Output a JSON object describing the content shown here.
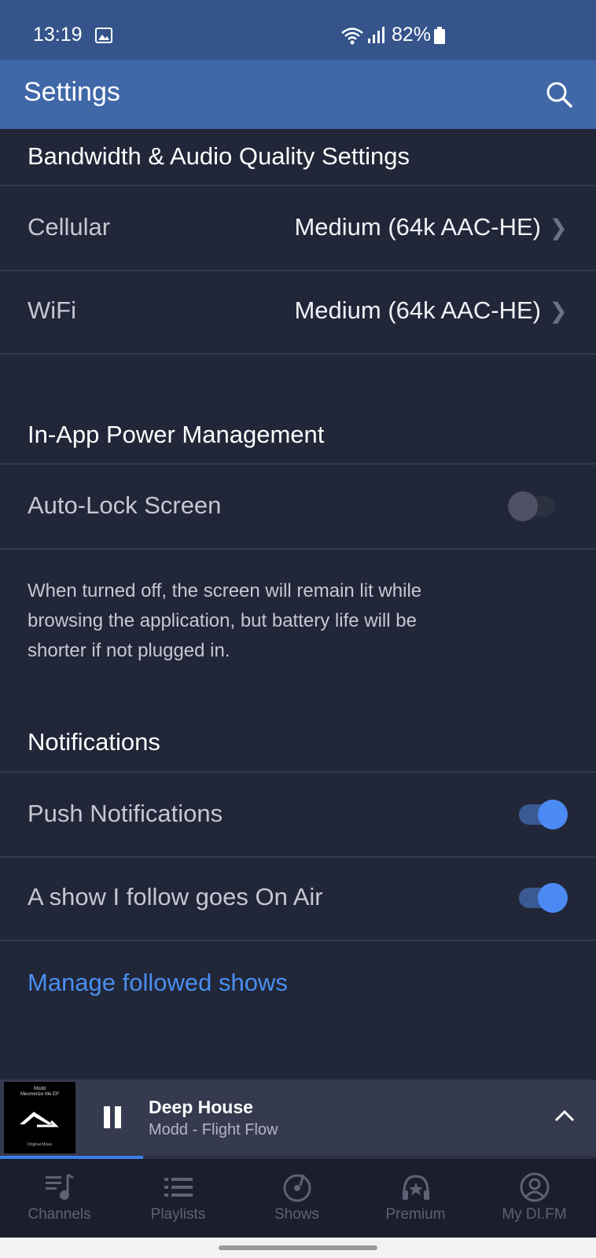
{
  "status_bar": {
    "time": "13:19",
    "battery": "82%",
    "icons": [
      "image-icon",
      "wifi-icon",
      "signal-icon",
      "battery-icon"
    ]
  },
  "app_bar": {
    "title": "Settings",
    "search_icon": "search-icon"
  },
  "sections": {
    "bandwidth": {
      "header": "Bandwidth & Audio Quality Settings",
      "cellular": {
        "label": "Cellular",
        "value": "Medium (64k AAC-HE)"
      },
      "wifi": {
        "label": "WiFi",
        "value": "Medium (64k AAC-HE)"
      }
    },
    "power": {
      "header": "In-App Power Management",
      "auto_lock": {
        "label": "Auto-Lock Screen",
        "enabled": false
      },
      "description": "When turned off, the screen will remain lit while browsing the application, but battery life will be shorter if not plugged in."
    },
    "notifications": {
      "header": "Notifications",
      "push": {
        "label": "Push Notifications",
        "enabled": true
      },
      "on_air": {
        "label": "A show I follow goes On Air",
        "enabled": true
      },
      "manage_link": "Manage followed shows"
    }
  },
  "player": {
    "title": "Deep House",
    "subtitle": "Modd - Flight Flow",
    "album_art": {
      "artist": "Modd",
      "album": "Mesmerize Me EP",
      "footer": "Original Mixes"
    },
    "progress": 0.24
  },
  "tabs": [
    {
      "label": "Channels",
      "icon": "channels-icon"
    },
    {
      "label": "Playlists",
      "icon": "playlists-icon"
    },
    {
      "label": "Shows",
      "icon": "shows-icon"
    },
    {
      "label": "Premium",
      "icon": "premium-icon"
    },
    {
      "label": "My DI.FM",
      "icon": "profile-icon"
    }
  ],
  "colors": {
    "status_bar": "#34548a",
    "app_bar": "#4068a8",
    "background": "#212638",
    "accent": "#4a8ff0"
  }
}
